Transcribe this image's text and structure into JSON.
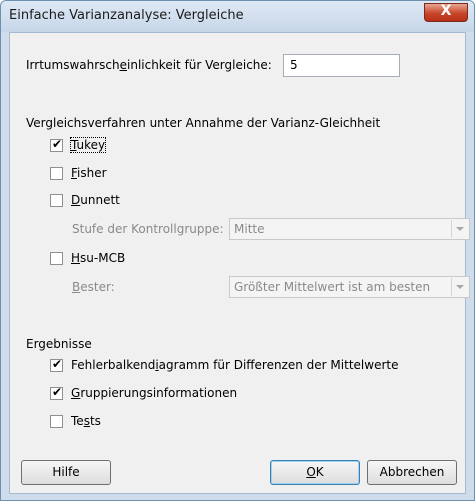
{
  "window": {
    "title": "Einfache Varianzanalyse: Vergleiche",
    "close_label": "X"
  },
  "alpha": {
    "label_pre": "Irrtumswahrsch",
    "label_accel": "e",
    "label_post": "inlichkeit für Vergleiche:",
    "value": "5"
  },
  "methods": {
    "heading": "Vergleichsverfahren unter Annahme der Varianz-Gleichheit",
    "tukey": {
      "accel": "T",
      "rest": "ukey",
      "checked": true
    },
    "fisher": {
      "accel": "F",
      "rest": "isher",
      "checked": false
    },
    "dunnett": {
      "accel": "D",
      "rest": "unnett",
      "checked": false
    },
    "control_group": {
      "label": "Stufe der Kontrollgruppe:",
      "value": "Mitte"
    },
    "hsu": {
      "accel": "H",
      "rest": "su-MCB",
      "checked": false
    },
    "best": {
      "label_accel": "B",
      "label_rest": "ester:",
      "value": "Größter Mittelwert ist am besten"
    }
  },
  "results": {
    "heading": "Ergebnisse",
    "interval_plot": {
      "pre": "Fehlerbalkend",
      "accel": "i",
      "post": "agramm für Differenzen der Mittelwerte",
      "checked": true
    },
    "grouping": {
      "accel": "G",
      "rest": "ruppierungsinformationen",
      "checked": true
    },
    "tests": {
      "pre": "Te",
      "accel": "s",
      "post": "ts",
      "checked": false
    }
  },
  "buttons": {
    "help": "Hilfe",
    "ok_accel": "O",
    "ok_rest": "K",
    "cancel": "Abbrechen"
  }
}
